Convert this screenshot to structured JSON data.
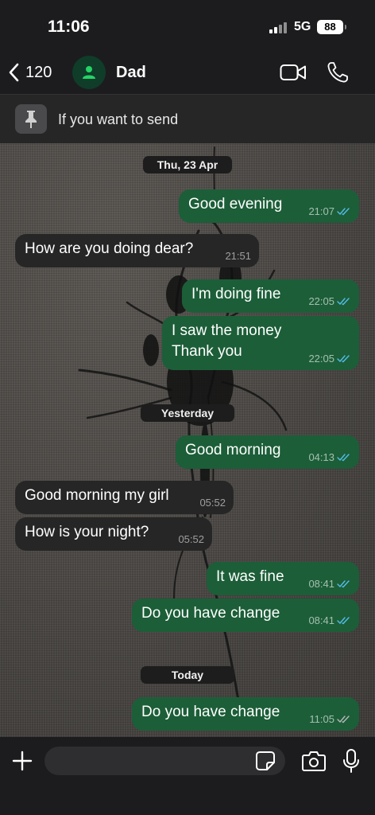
{
  "status_bar": {
    "time": "11:06",
    "network": "5G",
    "battery": "88"
  },
  "header": {
    "back_count": "120",
    "contact_name": "Dad"
  },
  "pinned": {
    "text": "If you want to send"
  },
  "dates": {
    "first": "Thu, 23 Apr",
    "second": "Yesterday",
    "third": "Today"
  },
  "messages": [
    {
      "direction": "out",
      "text": "Good evening",
      "time": "21:07",
      "status": "read"
    },
    {
      "direction": "in",
      "text": "How are you doing dear?",
      "time": "21:51"
    },
    {
      "direction": "out",
      "text": "I'm doing fine",
      "time": "22:05",
      "status": "read"
    },
    {
      "direction": "out",
      "text_line1": "I saw the money",
      "text_line2": "Thank you",
      "time": "22:05",
      "status": "read"
    },
    {
      "direction": "out",
      "text": "Good morning",
      "time": "04:13",
      "status": "read"
    },
    {
      "direction": "in",
      "text": "Good morning my girl",
      "time": "05:52"
    },
    {
      "direction": "in",
      "text": "How is your night?",
      "time": "05:52"
    },
    {
      "direction": "out",
      "text": "It was fine",
      "time": "08:41",
      "status": "read"
    },
    {
      "direction": "out",
      "text": "Do you have change",
      "time": "08:41",
      "status": "read"
    },
    {
      "direction": "out",
      "text": "Do you have change",
      "time": "11:05",
      "status": "delivered"
    }
  ],
  "colors": {
    "outgoing_bubble": "#1c5e38",
    "incoming_bubble": "#262626",
    "read_ticks": "#53bdeb",
    "delivered_ticks": "#b8b8b8",
    "accent": "#25d366"
  },
  "icons": [
    "back-chevron-icon",
    "person-icon",
    "video-icon",
    "phone-icon",
    "pin-icon",
    "plus-icon",
    "sticker-icon",
    "camera-icon",
    "mic-icon"
  ]
}
